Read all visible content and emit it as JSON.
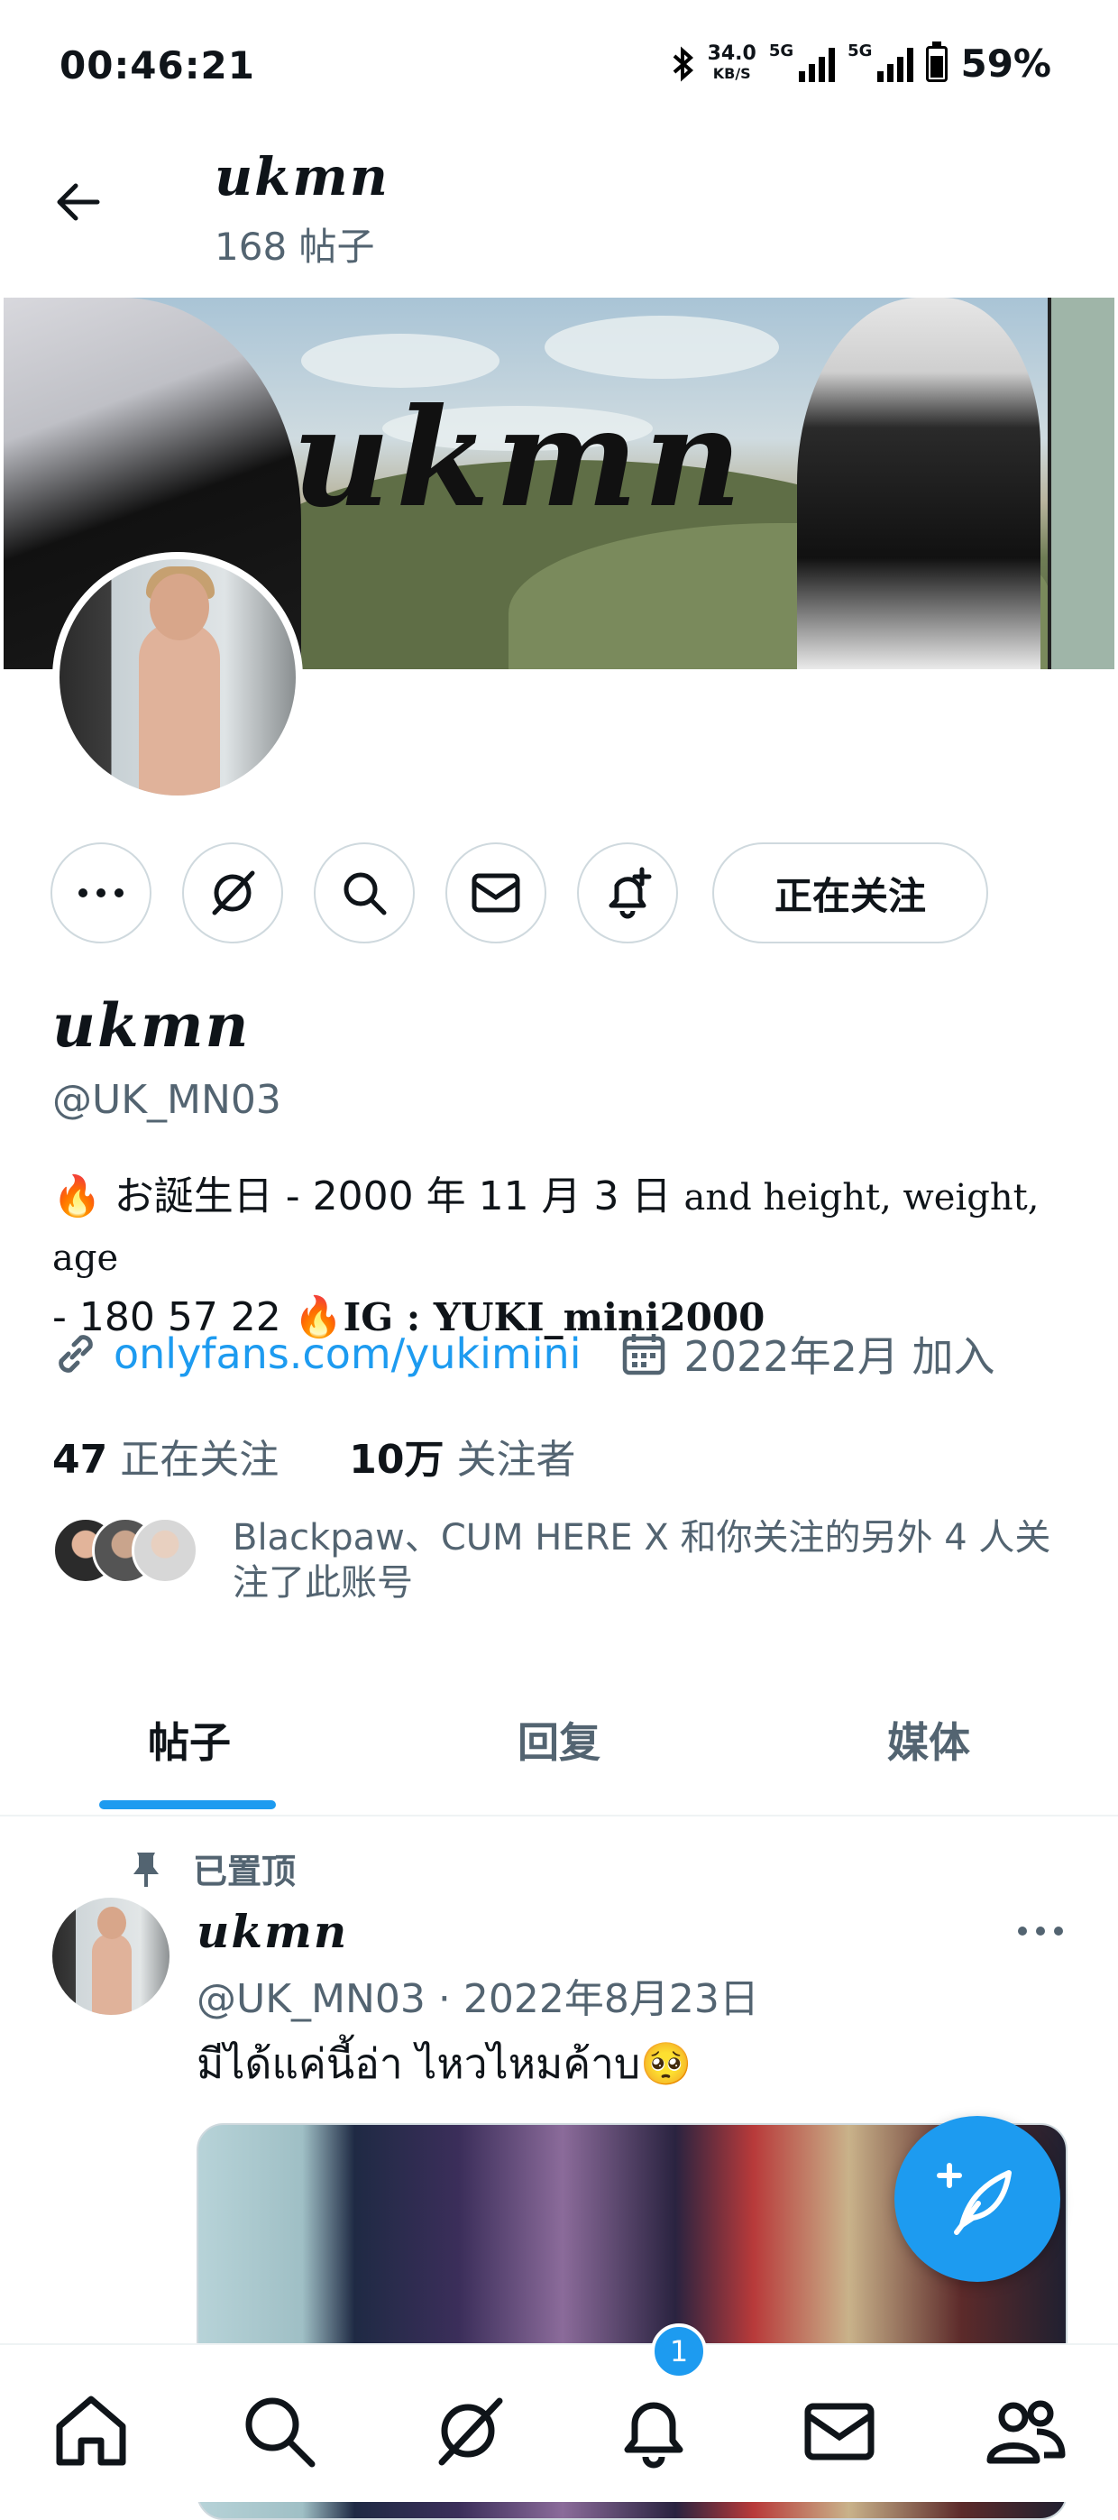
{
  "status_bar": {
    "time": "00:46:21",
    "net_speed": "34.0",
    "net_unit": "KB/S",
    "signal_label_1": "5G",
    "signal_label_2": "5G",
    "battery": "59%"
  },
  "header": {
    "title": "ukmn",
    "posts_count": "168 帖子"
  },
  "banner": {
    "title": "ukmn"
  },
  "actions": {
    "follow_label": "正在关注"
  },
  "profile": {
    "display_name": "ukmn",
    "handle": "@UK_MN03",
    "bio_line1_prefix": "🔥",
    "bio_line1_text": " お誕生日 - 2000 年 11 月 3 日 ",
    "bio_line1_serif": "and height, weight, age",
    "bio_line2_text": "- 180 57 22 ",
    "bio_line2_fire": "🔥",
    "bio_line2_ig": "IG : YUKI_mini2000",
    "link": "onlyfans.com/yukimini",
    "joined": "2022年2月 加入",
    "following_count": "47",
    "following_label": " 正在关注",
    "followers_count": "10万",
    "followers_label": " 关注者",
    "followed_by_text": "Blackpaw、CUM HERE X 和你关注的另外 4 人关注了此账号"
  },
  "tabs": [
    {
      "label": "帖子"
    },
    {
      "label": "回复"
    },
    {
      "label": "媒体"
    }
  ],
  "pinned_post": {
    "pinned_label": "已置顶",
    "author_name": "ukmn",
    "meta": "@UK_MN03 · 2022年8月23日",
    "text": "มีได้แค่นี้อ่า ไหวไหมค้าบ🥺"
  },
  "bottom_nav": {
    "notifications_badge": "1"
  },
  "colors": {
    "accent": "#1d9bf0",
    "secondary_text": "#536471",
    "border": "#cfd9de"
  },
  "icons": [
    "back-arrow-icon",
    "more-icon",
    "grok-icon",
    "search-icon",
    "mail-icon",
    "bell-plus-icon",
    "link-icon",
    "calendar-icon",
    "pin-icon",
    "compose-icon",
    "home-icon",
    "notifications-icon",
    "communities-icon"
  ]
}
